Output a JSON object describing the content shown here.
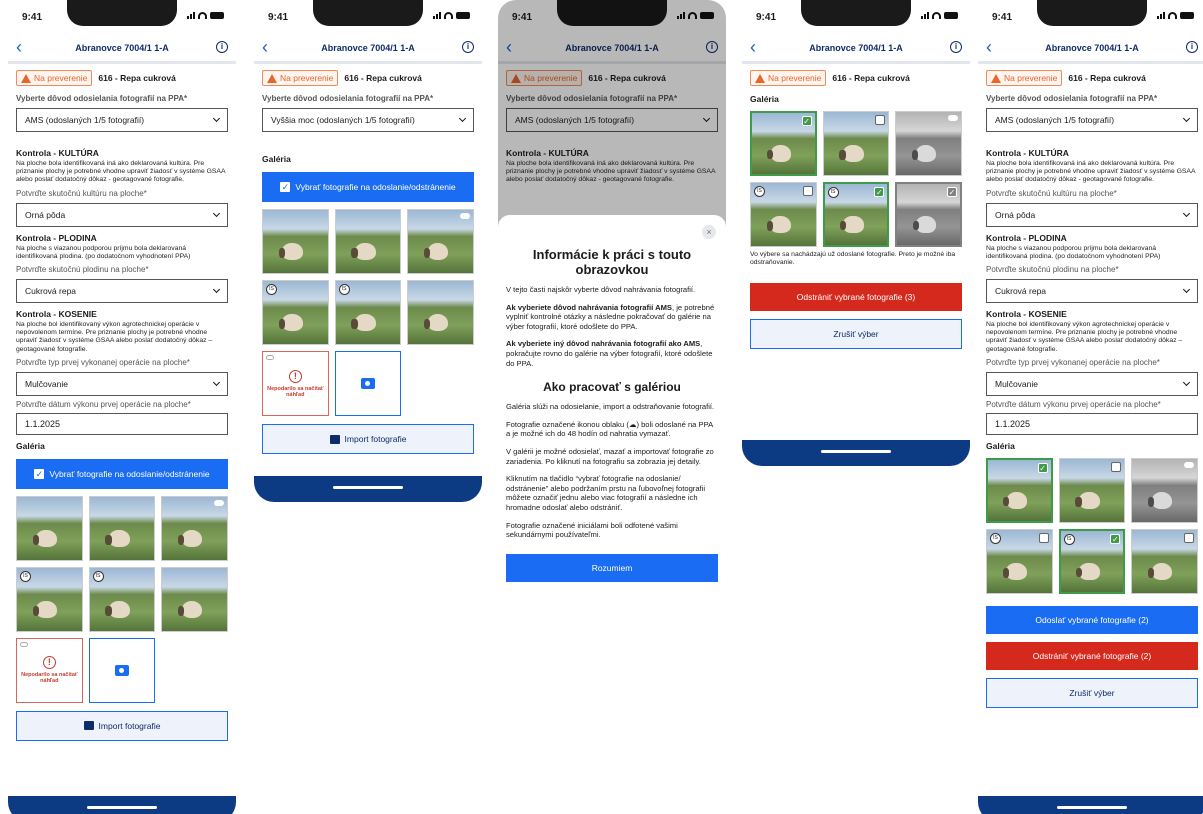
{
  "status_bar": {
    "time": "9:41"
  },
  "header": {
    "title": "Abranovce 7004/1 1-A"
  },
  "status": {
    "badge": "Na preverenie",
    "crop": "616 - Repa cukrová"
  },
  "reason": {
    "label": "Vyberte dôvod odosielania fotografií na PPA*",
    "ams_value": "AMS (odoslaných 1/5 fotografií)",
    "other_value": "Vyššia moc (odoslaných 1/5 fotografií)"
  },
  "kultura": {
    "title": "Kontrola - KULTÚRA",
    "desc": "Na ploche bola identifikovaná iná ako deklarovaná kultúra. Pre priznanie plochy je potrebné vhodne upraviť žiadosť v systéme GSAA alebo poslať dodatočný dôkaz - geotagované fotografie.",
    "field_label": "Potvrďte skutočnú kultúru na ploche*",
    "value": "Orná pôda"
  },
  "plodina": {
    "title": "Kontrola - PLODINA",
    "desc": "Na ploche s viazanou podporou príjmu bola deklarovaná identifikovaná plodina. (po dodatočnom vyhodnotení PPA)",
    "field_label": "Potvrďte skutočnú plodinu na ploche*",
    "value": "Cukrová repa"
  },
  "kosenie": {
    "title": "Kontrola - KOSENIE",
    "desc": "Na ploche bol identifikovaný výkon agrotechnickej operácie v nepovolenom termíne. Pre priznanie plochy je potrebné vhodne upraviť žiadosť v systéme GSAA alebo poslať dodatočný dôkaz – geotagované fotografie.",
    "op_label": "Potvrďte typ prvej vykonanej operácie na ploche*",
    "op_value": "Mulčovanie",
    "date_label": "Potvrďte dátum výkonu prvej operácie na ploche*",
    "date_value": "1.1.2025"
  },
  "gallery": {
    "title": "Galéria",
    "select_button": "Vybrať fotografie na odoslanie/odstránenie",
    "failed_text": "Nepodarilo sa načítať náhľad",
    "import_button": "Import fotografie",
    "initials": "IS",
    "fail_icon": "!",
    "check": "✓"
  },
  "screen4": {
    "note": "Vo výbere sa nachádzajú už odoslané fotografie. Preto je možné iba odstraňovanie.",
    "delete_button": "Odstrániť vybrané fotografie (3)",
    "cancel_button": "Zrušiť výber"
  },
  "screen5": {
    "send_button": "Odoslať vybrané fotografie (2)",
    "delete_button": "Odstrániť vybrané fotografie (2)",
    "cancel_button": "Zrušiť výber"
  },
  "modal": {
    "title": "Informácie k práci s touto obrazovkou",
    "close": "×",
    "p1": "V tejto časti najskôr vyberte dôvod nahrávania fotografií.",
    "p2_bold": "Ak vyberiete dôvod nahrávania fotografií AMS",
    "p2_rest": ", je potrebné vyplniť kontrolné otázky a následne pokračovať do galérie na výber fotografií, ktoré odošlete do PPA.",
    "p3_bold": "Ak vyberiete iný dôvod nahrávania fotografií ako AMS",
    "p3_rest": ", pokračujte rovno do galérie na výber fotografií, ktoré odošlete do PPA.",
    "subtitle": "Ako pracovať s galériou",
    "p4": "Galéria slúži na odosielanie, import a odstraňovanie fotografií.",
    "p5": "Fotografie označené ikonou oblaku (☁) boli odoslané na PPA a je možné ich do 48 hodín od nahratia vymazať.",
    "p6": "V galérii je možné odosielať, mazať a importovať fotografie zo zariadenia.  Po kliknutí na fotografiu sa zobrazia jej detaily.",
    "p7": "Kliknutím na tlačidlo “vybrať fotografie na odoslanie/ odstránenie” alebo podržaním prstu na ľubovoľnej fotografii môžete označiť jednu alebo viac fotografií a následne ich hromadne odoslať alebo odstrániť.",
    "p8": "Fotografie označené iniciálami boli odfotené vašimi sekundárnymi používateľmi.",
    "ok": "Rozumiem"
  }
}
